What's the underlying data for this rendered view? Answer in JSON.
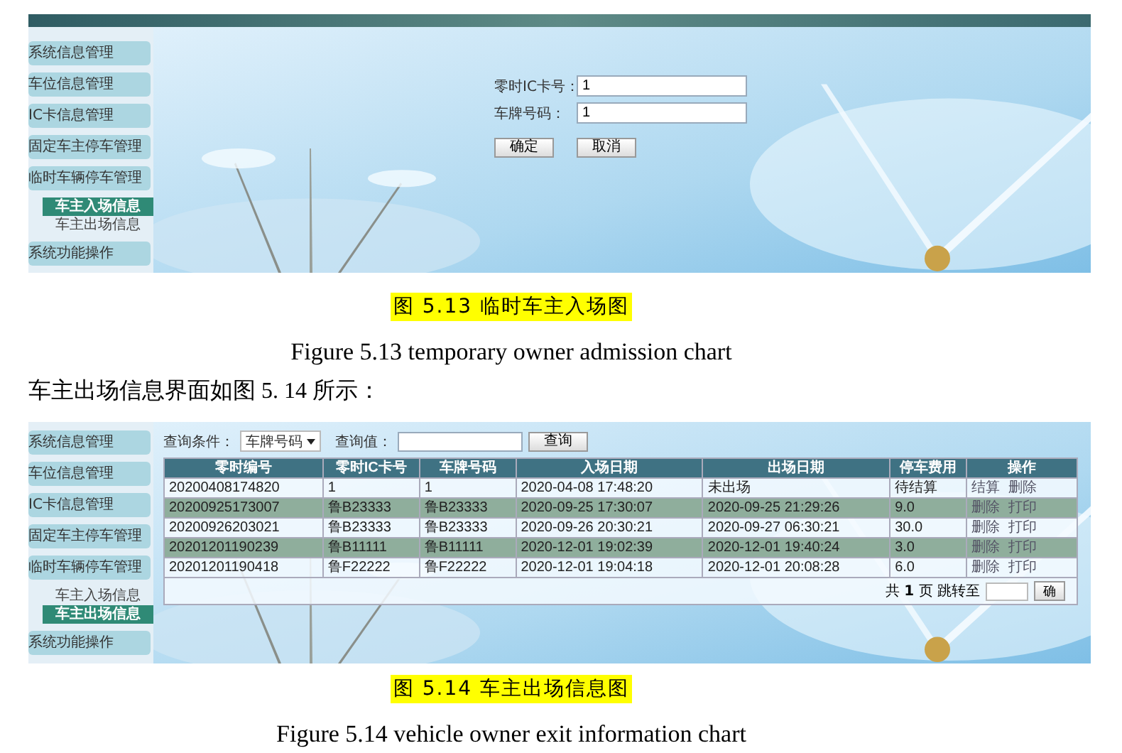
{
  "figure_1": {
    "sidebar": [
      {
        "label": "系统信息管理"
      },
      {
        "label": "车位信息管理"
      },
      {
        "label": "IC卡信息管理"
      },
      {
        "label": "固定车主停车管理"
      },
      {
        "label": "临时车辆停车管理",
        "children": [
          {
            "label": "车主入场信息",
            "selected": true
          },
          {
            "label": "车主出场信息",
            "selected": false
          }
        ]
      },
      {
        "label": "系统功能操作"
      }
    ],
    "form": {
      "fields": [
        {
          "label": "零时IC卡号：",
          "value": "1"
        },
        {
          "label": "车牌号码：",
          "value": "1"
        }
      ],
      "buttons": [
        "确定",
        "取消"
      ]
    },
    "caption_zh": "图 5.13 临时车主入场图",
    "caption_en": "Figure 5.13 temporary owner admission chart"
  },
  "paragraph": "车主出场信息界面如图 5. 14 所示：",
  "figure_2": {
    "sidebar": [
      {
        "label": "系统信息管理"
      },
      {
        "label": "车位信息管理"
      },
      {
        "label": "IC卡信息管理"
      },
      {
        "label": "固定车主停车管理"
      },
      {
        "label": "临时车辆停车管理",
        "children": [
          {
            "label": "车主入场信息",
            "selected": false
          },
          {
            "label": "车主出场信息",
            "selected": true
          }
        ]
      },
      {
        "label": "系统功能操作"
      }
    ],
    "query": {
      "condition_label": "查询条件：",
      "condition_value": "车牌号码",
      "value_label": "查询值：",
      "button": "查询"
    },
    "table": {
      "columns": [
        "零时编号",
        "零时IC卡号",
        "车牌号码",
        "入场日期",
        "出场日期",
        "停车费用",
        "操作"
      ],
      "rows": [
        {
          "cells": [
            "20200408174820",
            "1",
            "1",
            "2020-04-08 17:48:20",
            "未出场",
            "待结算"
          ],
          "actions": [
            "结算",
            "删除"
          ]
        },
        {
          "cells": [
            "20200925173007",
            "鲁B23333",
            "鲁B23333",
            "2020-09-25 17:30:07",
            "2020-09-25 21:29:26",
            "9.0"
          ],
          "actions": [
            "删除",
            "打印"
          ]
        },
        {
          "cells": [
            "20200926203021",
            "鲁B23333",
            "鲁B23333",
            "2020-09-26 20:30:21",
            "2020-09-27 06:30:21",
            "30.0"
          ],
          "actions": [
            "删除",
            "打印"
          ]
        },
        {
          "cells": [
            "20201201190239",
            "鲁B11111",
            "鲁B11111",
            "2020-12-01 19:02:39",
            "2020-12-01 19:40:24",
            "3.0"
          ],
          "actions": [
            "删除",
            "打印"
          ]
        },
        {
          "cells": [
            "20201201190418",
            "鲁F22222",
            "鲁F22222",
            "2020-12-01 19:04:18",
            "2020-12-01 20:08:28",
            "6.0"
          ],
          "actions": [
            "删除",
            "打印"
          ]
        }
      ]
    },
    "pager": {
      "text": "共 **1** 页 跳转至",
      "button": "确"
    },
    "caption_zh": "图 5.14 车主出场信息图",
    "caption_en": "Figure 5.14 vehicle owner exit information chart"
  }
}
